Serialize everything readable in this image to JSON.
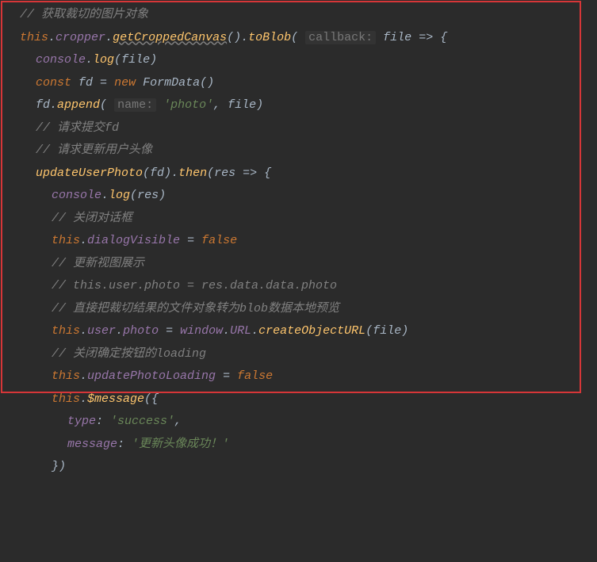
{
  "lines": {
    "l1_comment": "// 获取裁切的图片对象",
    "l2_this": "this",
    "l2_cropper": "cropper",
    "l2_getCropped": "getCroppedCanvas",
    "l2_toBlob": "toBlob",
    "l2_callback": "callback:",
    "l2_file": "file",
    "l2_arrow": " => {",
    "l3_console": "console",
    "l3_log": "log",
    "l3_file": "file",
    "l4_const": "const",
    "l4_fd": "fd",
    "l4_eq": " = ",
    "l4_new": "new",
    "l4_formdata": "FormData",
    "l5_fd": "fd",
    "l5_append": "append",
    "l5_name": "name:",
    "l5_photo": "'photo'",
    "l5_file": "file",
    "l6_comment": "// 请求提交fd",
    "l7_comment": "// 请求更新用户头像",
    "l8_updateUserPhoto": "updateUserPhoto",
    "l8_fd": "fd",
    "l8_then": "then",
    "l8_res": "res",
    "l8_arrow": " => {",
    "l9_console": "console",
    "l9_log": "log",
    "l9_res": "res",
    "l10_comment": "// 关闭对话框",
    "l11_this": "this",
    "l11_dialogVisible": "dialogVisible",
    "l11_eq": " = ",
    "l11_false": "false",
    "l12_comment": "// 更新视图展示",
    "l13_comment": "// this.user.photo = res.data.data.photo",
    "l14_comment": "// 直接把裁切结果的文件对象转为blob数据本地预览",
    "l15_this": "this",
    "l15_user": "user",
    "l15_photo": "photo",
    "l15_eq": " = ",
    "l15_window": "window",
    "l15_url": "URL",
    "l15_createObjectURL": "createObjectURL",
    "l15_file": "file",
    "l16_comment": "// 关闭确定按钮的loading",
    "l17_this": "this",
    "l17_updatePhotoLoading": "updatePhotoLoading",
    "l17_eq": " = ",
    "l17_false": "false",
    "l18_this": "this",
    "l18_message": "$message",
    "l19_type": "type",
    "l19_success": "'success'",
    "l20_message": "message",
    "l20_text": "'更新头像成功！'",
    "l21_close": "})"
  }
}
